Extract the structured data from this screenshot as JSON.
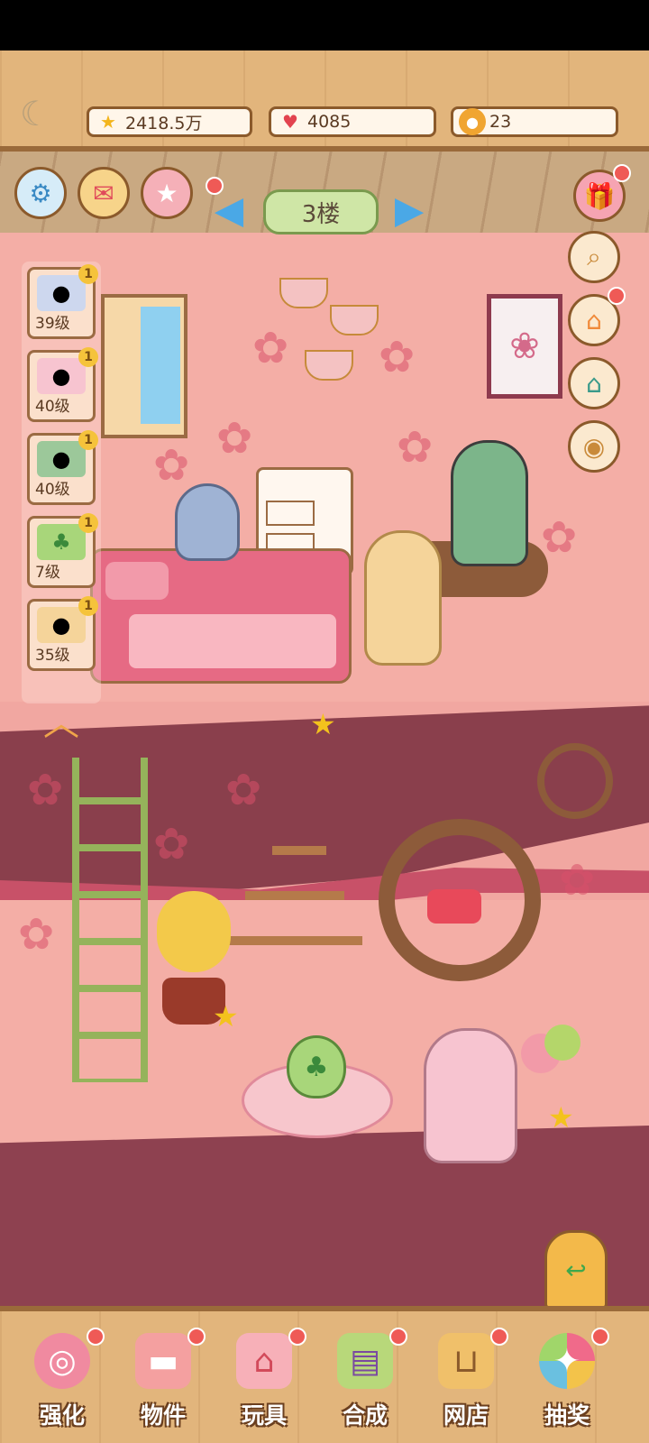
{
  "header": {
    "coins": "2418.5万",
    "hearts": "4085",
    "paws": "23"
  },
  "floor": {
    "label": "3楼"
  },
  "cats": [
    {
      "level": "39级",
      "badge": "1",
      "icon": "koala-cat"
    },
    {
      "level": "40级",
      "badge": "1",
      "icon": "pink-cat"
    },
    {
      "level": "40级",
      "badge": "1",
      "icon": "girl-cat"
    },
    {
      "level": "7级",
      "badge": "1",
      "icon": "clover-egg"
    },
    {
      "level": "35级",
      "badge": "1",
      "icon": "blonde-cat"
    }
  ],
  "nav": {
    "tabs": [
      {
        "label": "强化",
        "icon": "candy-icon"
      },
      {
        "label": "物件",
        "icon": "sofa-icon"
      },
      {
        "label": "玩具",
        "icon": "house-toy-icon"
      },
      {
        "label": "合成",
        "icon": "cards-icon"
      },
      {
        "label": "网店",
        "icon": "basket-icon"
      },
      {
        "label": "抽奖",
        "icon": "wheel-icon"
      }
    ]
  },
  "colors": {
    "wall": "#f4aea6",
    "floor": "#8a3f4c",
    "frame": "#e2b57c",
    "accent": "#ef5a56"
  }
}
